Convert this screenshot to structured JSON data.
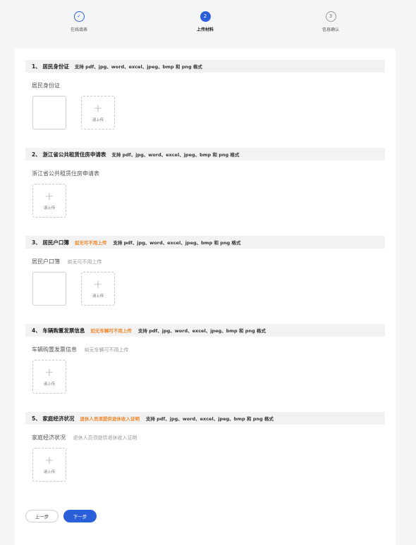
{
  "steps": [
    {
      "index": "✓",
      "label": "在线填表",
      "state": "done"
    },
    {
      "index": "2",
      "label": "上传材料",
      "state": "active"
    },
    {
      "index": "3",
      "label": "信息确认",
      "state": "todo"
    }
  ],
  "sections": [
    {
      "title": "1、 居民身份证",
      "warning": "",
      "formats": "支持 pdf、jpg、word、excel、jpeg、bmp 和 png 格式",
      "field_label": "居民身份证",
      "field_hint": "",
      "has_file": true
    },
    {
      "title": "2、 浙江省公共租赁住房申请表",
      "warning": "",
      "formats": "支持 pdf、jpg、word、excel、jpeg、bmp 和 png 格式",
      "field_label": "浙江省公共租赁住房申请表",
      "field_hint": "",
      "has_file": false
    },
    {
      "title": "3、 居民户口簿",
      "warning": "如无可不用上传",
      "formats": "支持 pdf、jpg、word、excel、jpeg、bmp 和 png 格式",
      "field_label": "居民户口簿",
      "field_hint": "如无可不用上传",
      "has_file": true
    },
    {
      "title": "4、 车辆购置发票信息",
      "warning": "如无车辆可不用上传",
      "formats": "支持 pdf、jpg、word、excel、jpeg、bmp 和 png 格式",
      "field_label": "车辆购置发票信息",
      "field_hint": "如无车辆可不用上传",
      "has_file": false
    },
    {
      "title": "5、 家庭经济状况",
      "warning": "退休人员须提供退休收入证明",
      "formats": "支持 pdf、jpg、word、excel、jpeg、bmp 和 png 格式",
      "field_label": "家庭经济状况",
      "field_hint": "退休人员须提供退休收入证明",
      "has_file": false
    }
  ],
  "upload": {
    "plus": "+",
    "label": "请上传"
  },
  "buttons": {
    "prev": "上一步",
    "next": "下一步"
  },
  "colors": {
    "primary": "#2b5fd9",
    "warning": "#f0862a",
    "background": "#f4f5f7"
  }
}
